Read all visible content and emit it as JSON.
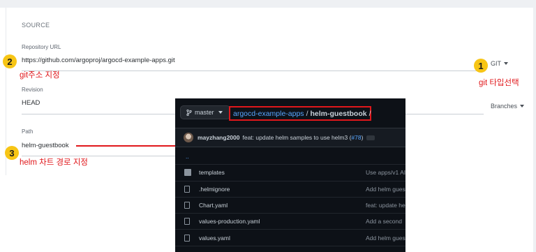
{
  "form": {
    "section_title": "SOURCE",
    "repo_url_label": "Repository URL",
    "repo_url_value": "https://github.com/argoproj/argocd-example-apps.git",
    "type_dropdown": "GIT",
    "revision_label": "Revision",
    "revision_value": "HEAD",
    "revision_dropdown": "Branches",
    "path_label": "Path",
    "path_value": "helm-guestbook"
  },
  "annotations": [
    {
      "number": "1",
      "text": "git 타입선택"
    },
    {
      "number": "2",
      "text": "git주소 지정"
    },
    {
      "number": "3",
      "text": "helm 차트 경로 지정"
    }
  ],
  "colors": {
    "annotation_red": "#e0171b",
    "badge_yellow": "#f7c515",
    "github_bg": "#0d1117",
    "github_link": "#58a6ff"
  },
  "github": {
    "branch": "master",
    "breadcrumb_repo": "argocd-example-apps",
    "breadcrumb_sep": "/",
    "breadcrumb_dir": "helm-guestbook",
    "breadcrumb_tail": "/",
    "commit_author": "mayzhang2000",
    "commit_message": "feat: update helm samples to use helm3 (",
    "commit_link": "#78",
    "commit_close": ")",
    "parent_dir": "..",
    "files": [
      {
        "name": "templates",
        "type": "folder",
        "message": "Use apps/v1 AI"
      },
      {
        "name": ".helmignore",
        "type": "file",
        "message": "Add helm gues"
      },
      {
        "name": "Chart.yaml",
        "type": "file",
        "message": "feat: update he"
      },
      {
        "name": "values-production.yaml",
        "type": "file",
        "message": "Add a second"
      },
      {
        "name": "values.yaml",
        "type": "file",
        "message": "Add helm gues"
      }
    ]
  }
}
